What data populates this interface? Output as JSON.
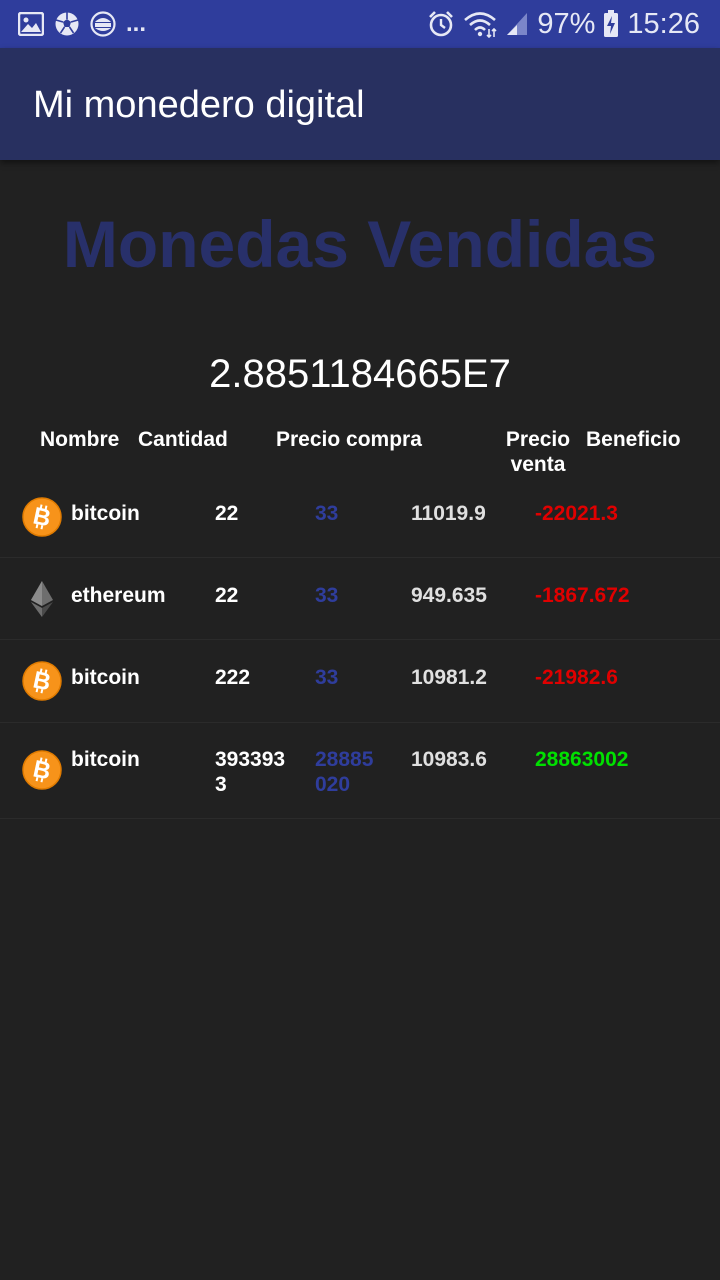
{
  "status_bar": {
    "left_icons": [
      "image-icon",
      "soccer-ball-icon",
      "burger-king-icon"
    ],
    "overflow": "...",
    "battery": "97%",
    "time": "15:26"
  },
  "app_bar": {
    "title": "Mi monedero digital"
  },
  "section": {
    "title": "Monedas Vendidas"
  },
  "total": "2.8851184665E7",
  "table": {
    "headers": {
      "nombre": "Nombre",
      "cantidad": "Cantidad",
      "precio_compra": "Precio compra",
      "precio_venta_1": "Precio",
      "precio_venta_2": "venta",
      "beneficio": "Beneficio"
    },
    "rows": [
      {
        "icon": "bitcoin-icon",
        "nombre": "bitcoin",
        "cantidad_1": "22",
        "cantidad_2": "",
        "compra_1": "33",
        "compra_2": "",
        "venta": "11019.9",
        "beneficio": "-22021.3",
        "beneficio_color": "#e00000"
      },
      {
        "icon": "ethereum-icon",
        "nombre": "ethereum",
        "cantidad_1": "22",
        "cantidad_2": "",
        "compra_1": "33",
        "compra_2": "",
        "venta": "949.635",
        "beneficio": "-1867.672",
        "beneficio_color": "#e00000"
      },
      {
        "icon": "bitcoin-icon",
        "nombre": "bitcoin",
        "cantidad_1": "222",
        "cantidad_2": "",
        "compra_1": "33",
        "compra_2": "",
        "venta": "10981.2",
        "beneficio": "-21982.6",
        "beneficio_color": "#e00000"
      },
      {
        "icon": "bitcoin-icon",
        "nombre": "bitcoin",
        "cantidad_1": "393393",
        "cantidad_2": "3",
        "compra_1": "28885",
        "compra_2": "020",
        "venta": "10983.6",
        "beneficio": "28863002",
        "beneficio_color": "#00e000"
      }
    ]
  },
  "colors": {
    "status_bar": "#2f3d9c",
    "app_bar": "#283060",
    "background": "#212121",
    "section_title": "#28306a",
    "precio_compra": "#2f3d9c",
    "precio_venta": "#e0e0e0",
    "loss": "#e00000",
    "gain": "#00e000"
  }
}
